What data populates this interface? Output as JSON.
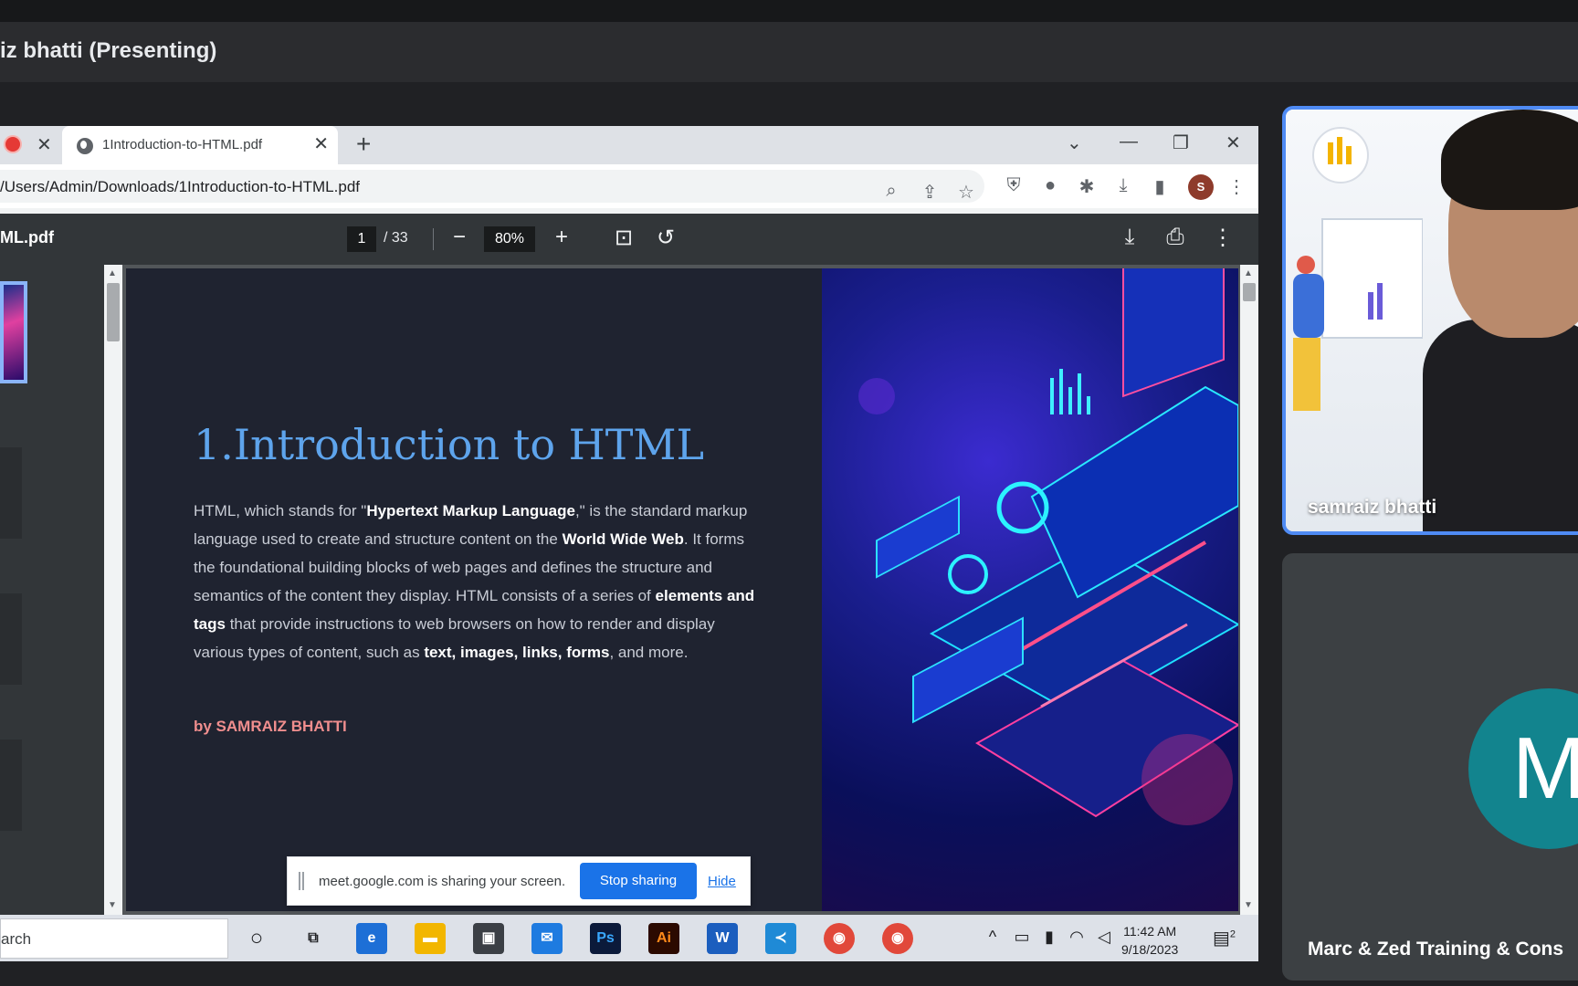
{
  "meet": {
    "presenter_label": "iz bhatti (Presenting)",
    "participants": [
      {
        "name": "samraiz bhatti"
      },
      {
        "name": "Marc & Zed Training & Cons",
        "avatar_letter": "M"
      }
    ]
  },
  "browser": {
    "tab_title": "1Introduction-to-HTML.pdf",
    "url": "/Users/Admin/Downloads/1Introduction-to-HTML.pdf",
    "profile_letter": "S"
  },
  "pdf_viewer": {
    "file_name": "ML.pdf",
    "current_page": "1",
    "page_total": "/ 33",
    "zoom": "80%"
  },
  "slide": {
    "title": "1.Introduction to HTML",
    "body_parts": [
      {
        "t": "HTML, which stands for \"",
        "b": false
      },
      {
        "t": "Hypertext Markup Language",
        "b": true
      },
      {
        "t": ",\" is the standard markup language used to create and structure content on the ",
        "b": false
      },
      {
        "t": "World Wide Web",
        "b": true
      },
      {
        "t": ". It forms the foundational building blocks of web pages and defines the structure and semantics of the content they display. HTML consists of a series of ",
        "b": false
      },
      {
        "t": "elements and tags",
        "b": true
      },
      {
        "t": " that provide instructions to web browsers on how to render and display various types of content, such as ",
        "b": false
      },
      {
        "t": "text, images, links, forms",
        "b": true
      },
      {
        "t": ", and more.",
        "b": false
      }
    ],
    "author": "by SAMRAIZ BHATTI"
  },
  "share_bar": {
    "message": "meet.google.com is sharing your screen.",
    "stop_label": "Stop sharing",
    "hide_label": "Hide"
  },
  "taskbar": {
    "search_text": "arch",
    "time": "11:42 AM",
    "date": "9/18/2023",
    "notification_count": "2",
    "apps": [
      "cortana",
      "task-view",
      "edge",
      "file-explorer",
      "store",
      "mail",
      "photoshop",
      "illustrator",
      "word",
      "vscode",
      "chrome",
      "chrome"
    ]
  },
  "colors": {
    "accent_blue": "#1a73e8",
    "slide_title": "#5ea4ec",
    "author": "#f08e8e",
    "active_speaker_border": "#4f8bf4",
    "m_avatar": "#12848e"
  }
}
